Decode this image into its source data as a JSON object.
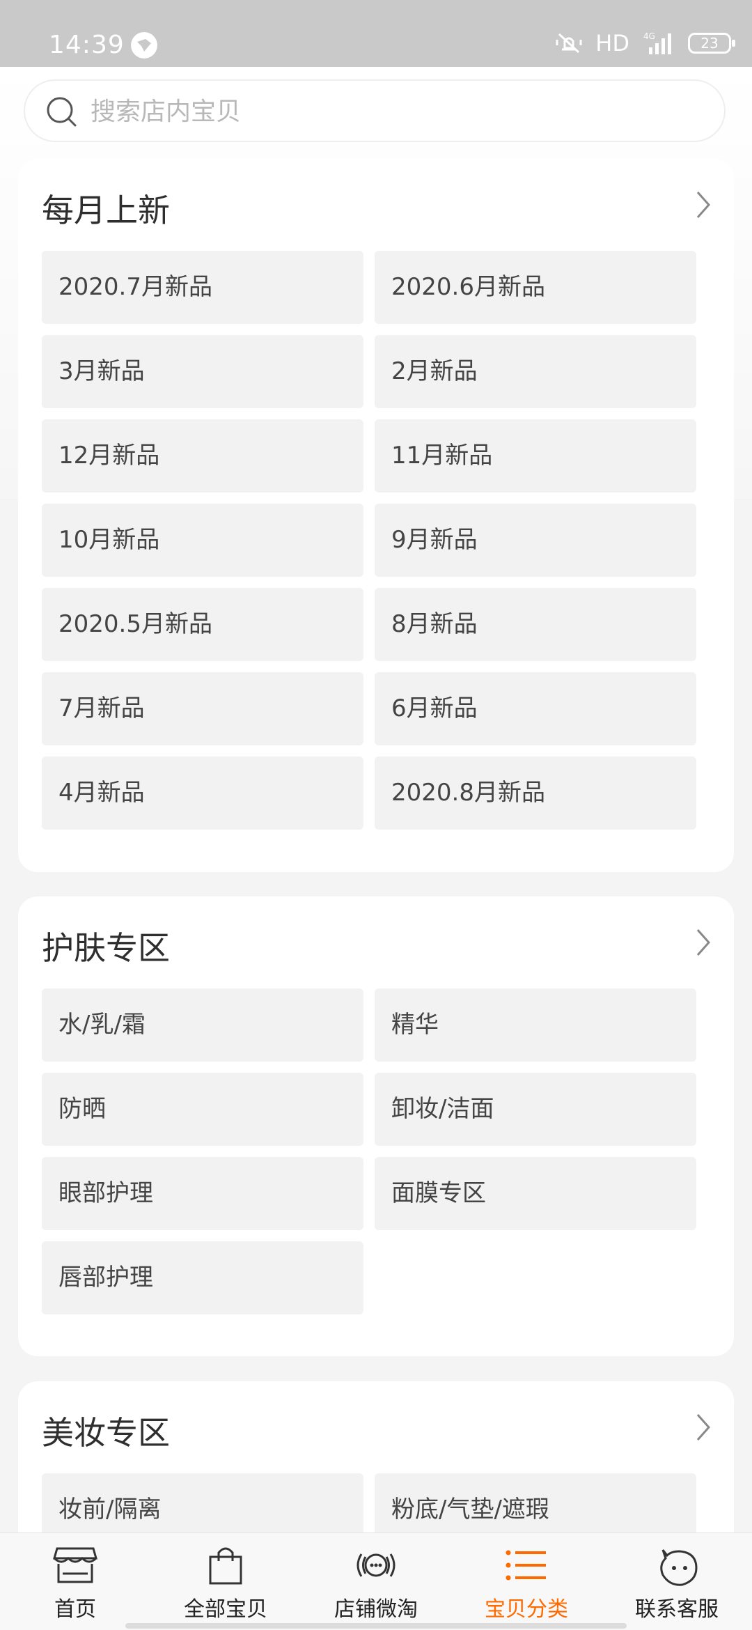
{
  "status": {
    "time": "14:39",
    "network": "HD",
    "signal": "4G",
    "battery": "23"
  },
  "search": {
    "placeholder": "搜索店内宝贝"
  },
  "sections": [
    {
      "title": "每月上新",
      "items": [
        "2020.7月新品",
        "2020.6月新品",
        "3月新品",
        "2月新品",
        "12月新品",
        "11月新品",
        "10月新品",
        "9月新品",
        "2020.5月新品",
        "8月新品",
        "7月新品",
        "6月新品",
        "4月新品",
        "2020.8月新品"
      ]
    },
    {
      "title": "护肤专区",
      "items": [
        "水/乳/霜",
        "精华",
        "防晒",
        "卸妆/洁面",
        "眼部护理",
        "面膜专区",
        "唇部护理"
      ]
    },
    {
      "title": "美妆专区",
      "items": [
        "妆前/隔离",
        "粉底/气垫/遮瑕"
      ]
    }
  ],
  "tabs": [
    {
      "label": "首页",
      "icon": "store-icon"
    },
    {
      "label": "全部宝贝",
      "icon": "shopping-bag-icon"
    },
    {
      "label": "店铺微淘",
      "icon": "broadcast-icon"
    },
    {
      "label": "宝贝分类",
      "icon": "list-icon",
      "active": true
    },
    {
      "label": "联系客服",
      "icon": "chat-face-icon"
    }
  ],
  "colors": {
    "accent": "#ff6a00",
    "cell_bg": "#f2f2f2",
    "status_bg": "#c9c9c9"
  }
}
